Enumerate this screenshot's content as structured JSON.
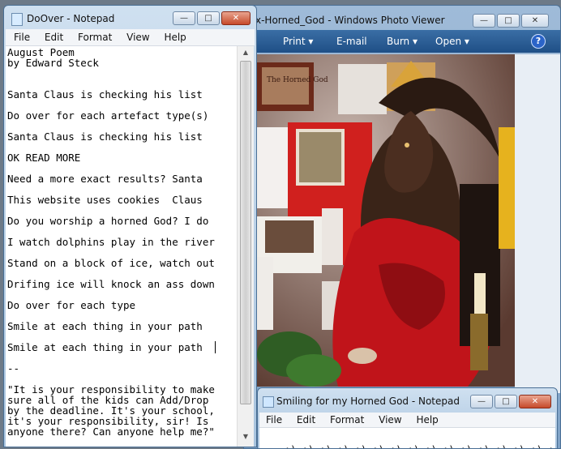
{
  "photo_viewer": {
    "title": "x-Horned_God - Windows Photo Viewer",
    "toolbar": {
      "print": "Print",
      "email": "E-mail",
      "burn": "Burn",
      "open": "Open"
    }
  },
  "notepad_main": {
    "title": "DoOver - Notepad",
    "menu": [
      "File",
      "Edit",
      "Format",
      "View",
      "Help"
    ],
    "lines": [
      "August Poem",
      "by Edward Steck",
      "Santa Claus is checking his list",
      "Do over for each artefact type(s)",
      "Santa Claus is checking his list",
      "OK READ MORE",
      "Need a more exact results? Santa",
      "This website uses cookies  Claus",
      "Do you worship a horned God? I do",
      "I watch dolphins play in the river",
      "Stand on a block of ice, watch out",
      "Drifing ice will knock an ass down",
      "Do over for each type",
      "Smile at each thing in your path",
      "Smile at each thing in your path",
      "--",
      "\"It is your responsibility to make",
      "sure all of the kids can Add/Drop",
      "by the deadline. It's your school,",
      "it's your responsibility, sir! Is",
      "anyone there? Can anyone help me?\""
    ]
  },
  "notepad_small": {
    "title": "Smiling for my Horned God - Notepad",
    "menu": [
      "File",
      "Edit",
      "Format",
      "View",
      "Help"
    ],
    "content": ":) :) :) :) :) :) :) :) :) :) :) :) :) :) :) :) :) :)"
  },
  "photo_texts": {
    "sign": "The Horned God"
  }
}
